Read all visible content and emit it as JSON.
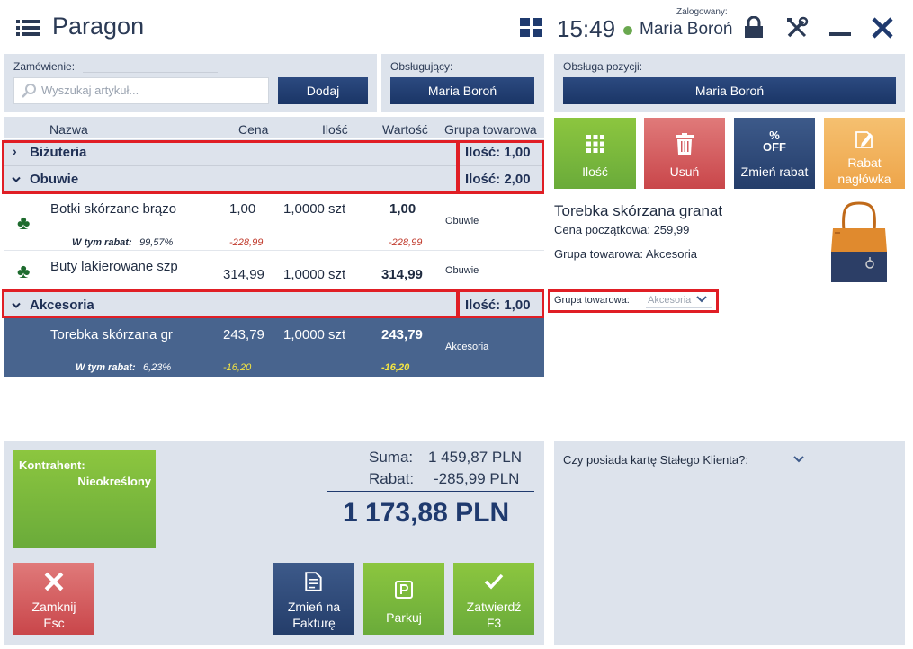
{
  "header": {
    "title": "Paragon",
    "time": "15:49",
    "login_label": "Zalogowany:",
    "user": "Maria Boroń"
  },
  "order": {
    "label": "Zamówienie:",
    "search_placeholder": "Wyszukaj artykuł...",
    "add_label": "Dodaj"
  },
  "serving": {
    "label": "Obsługujący:",
    "value": "Maria Boroń"
  },
  "position_service": {
    "label": "Obsługa pozycji:",
    "value": "Maria Boroń"
  },
  "table": {
    "columns": [
      "Nazwa",
      "Cena",
      "Ilość",
      "Wartość",
      "Grupa towarowa"
    ],
    "groups": {
      "bizuteria": {
        "name": "Biżuteria",
        "qty": "Ilość: 1,00"
      },
      "obuwie": {
        "name": "Obuwie",
        "qty": "Ilość: 2,00"
      },
      "akcesoria": {
        "name": "Akcesoria",
        "qty": "Ilość: 1,00"
      }
    },
    "rows": [
      {
        "name": "Botki skórzane brązo",
        "price": "1,00",
        "qty": "1,0000 szt",
        "value": "1,00",
        "group": "Obuwie",
        "discount_label": "W tym rabat:",
        "discount_pct": "99,57%",
        "price_disc": "-228,99",
        "value_disc": "-228,99"
      },
      {
        "name": "Buty lakierowane szp",
        "price": "314,99",
        "qty": "1,0000 szt",
        "value": "314,99",
        "group": "Obuwie"
      },
      {
        "name": "Torebka skórzana gr",
        "price": "243,79",
        "qty": "1,0000 szt",
        "value": "243,79",
        "group": "Akcesoria",
        "discount_label": "W tym rabat:",
        "discount_pct": "6,23%",
        "price_disc": "-16,20",
        "value_disc": "-16,20"
      }
    ]
  },
  "tiles": {
    "qty": "Ilość",
    "delete": "Usuń",
    "change_discount": "Zmień rabat",
    "off_top": "%",
    "off_bottom": "OFF",
    "header_discount_1": "Rabat",
    "header_discount_2": "nagłówka"
  },
  "product": {
    "name": "Torebka skórzana granat",
    "start_price": "Cena początkowa: 259,99",
    "group": "Grupa towarowa: Akcesoria",
    "group_select_label": "Grupa towarowa:",
    "group_select_value": "Akcesoria"
  },
  "contractor": {
    "label": "Kontrahent:",
    "value": "Nieokreślony"
  },
  "totals": {
    "sum_label": "Suma:",
    "sum_value": "1 459,87 PLN",
    "discount_label": "Rabat:",
    "discount_value": "-285,99 PLN",
    "total": "1 173,88 PLN"
  },
  "loyalty": {
    "question": "Czy posiada kartę Stałego Klienta?:"
  },
  "buttons": {
    "close_1": "Zamknij",
    "close_2": "Esc",
    "invoice_1": "Zmień na",
    "invoice_2": "Fakturę",
    "park": "Parkuj",
    "confirm_1": "Zatwierdź",
    "confirm_2": "F3"
  },
  "colors": {
    "accent_navy": "#1f3a6e",
    "selected_row": "#48648e",
    "green": "#8cc63f",
    "red": "#d15a5e",
    "orange": "#f2b35c",
    "highlight_box": "#e01e25"
  }
}
